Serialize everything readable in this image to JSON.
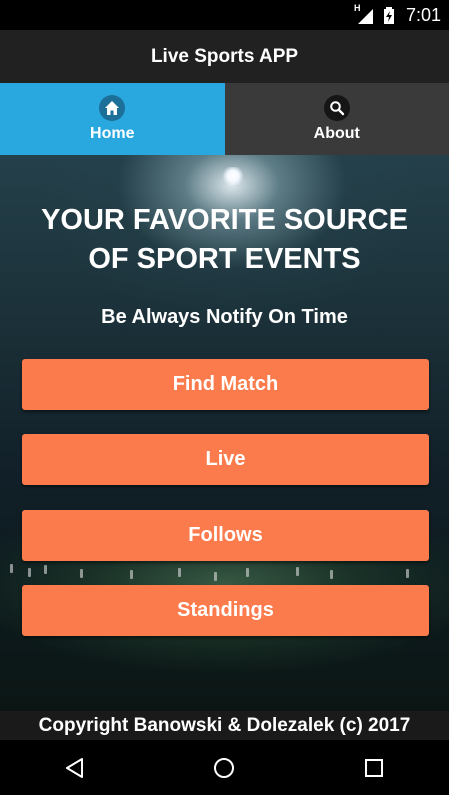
{
  "status_bar": {
    "time": "7:01",
    "network": "H"
  },
  "app_bar": {
    "title": "Live Sports APP"
  },
  "tabs": [
    {
      "label": "Home",
      "icon": "home-icon",
      "active": true
    },
    {
      "label": "About",
      "icon": "search-icon",
      "active": false
    }
  ],
  "hero": {
    "headline_line1": "YOUR FAVORITE SOURCE",
    "headline_line2": "OF SPORT EVENTS",
    "subheadline": "Be Always Notify On Time"
  },
  "buttons": {
    "find_match": "Find Match",
    "live": "Live",
    "follows": "Follows",
    "standings": "Standings"
  },
  "footer": {
    "copyright": "Copyright Banowski & Dolezalek (c) 2017"
  },
  "colors": {
    "accent_tab": "#29a8e0",
    "button": "#fc7b4c",
    "app_bar": "#212121"
  }
}
